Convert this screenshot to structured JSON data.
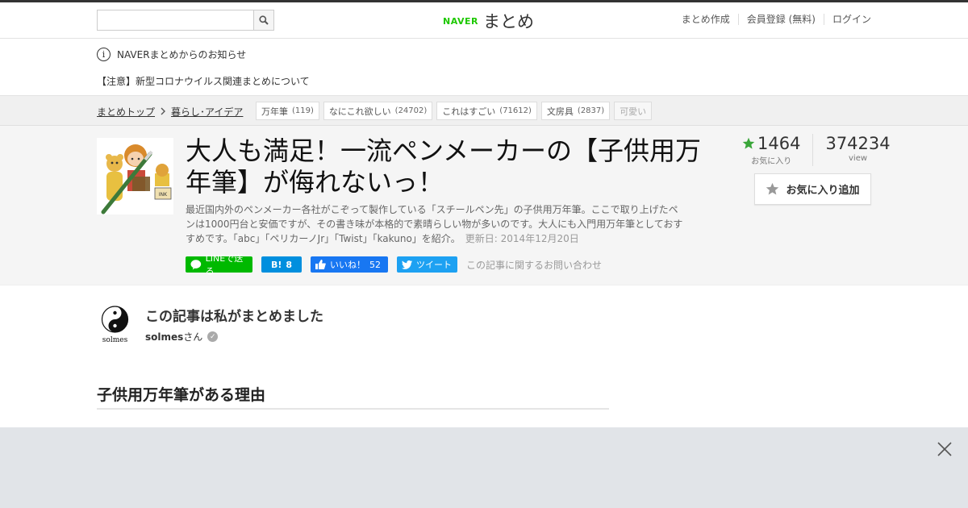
{
  "header": {
    "search_placeholder": "",
    "logo_brand": "NAVER",
    "logo_text": "まとめ",
    "nav": [
      "まとめ作成",
      "会員登録 (無料)",
      "ログイン"
    ]
  },
  "notice": {
    "title": "NAVERまとめからのお知らせ",
    "item": "【注意】新型コロナウイルス関連まとめについて"
  },
  "breadcrumb": {
    "home": "まとめトップ",
    "category": "暮らし･アイデア"
  },
  "tags": [
    {
      "label": "万年筆",
      "count": "(119)"
    },
    {
      "label": "なにこれ欲しい",
      "count": "(24702)"
    },
    {
      "label": "これはすごい",
      "count": "(71612)"
    },
    {
      "label": "文房具",
      "count": "(2837)"
    },
    {
      "label": "可愛い",
      "count": ""
    }
  ],
  "article": {
    "title": "大人も満足！一流ペンメーカーの【子供用万年筆】が侮れないっ！",
    "description": "最近国内外のペンメーカー各社がこぞって製作している「スチールペン先」の子供用万年筆。ここで取り上げたペンは1000円台と安価ですが、その書き味が本格的で素晴らしい物が多いのです。大人にも入門用万年筆としておすすめです。「abc」「ペリカーノJr」「Twist」「kakuno」を紹介。",
    "updated": "更新日: 2014年12月20日",
    "thumb_label": "INK"
  },
  "share": {
    "line": "LINEで送る",
    "hatena_label": "B!",
    "hatena_count": "8",
    "fb_label": "いいね！",
    "fb_count": "52",
    "tweet": "ツイート",
    "contact": "この記事に関するお問い合わせ"
  },
  "stats": {
    "favorites": "1464",
    "favorites_label": "お気に入り",
    "views": "374234",
    "views_label": "view",
    "fav_button": "お気に入り追加"
  },
  "author": {
    "heading": "この記事は私がまとめました",
    "name": "solmes",
    "suffix": "さん",
    "avatar_caption": "solmes"
  },
  "section": {
    "heading": "子供用万年筆がある理由"
  },
  "colors": {
    "naver_green": "#1ec800",
    "line_green": "#00b900",
    "hatena_blue": "#008fde",
    "facebook_blue": "#1877f2",
    "twitter_blue": "#1da1f2",
    "star_green": "#3aa63a"
  }
}
